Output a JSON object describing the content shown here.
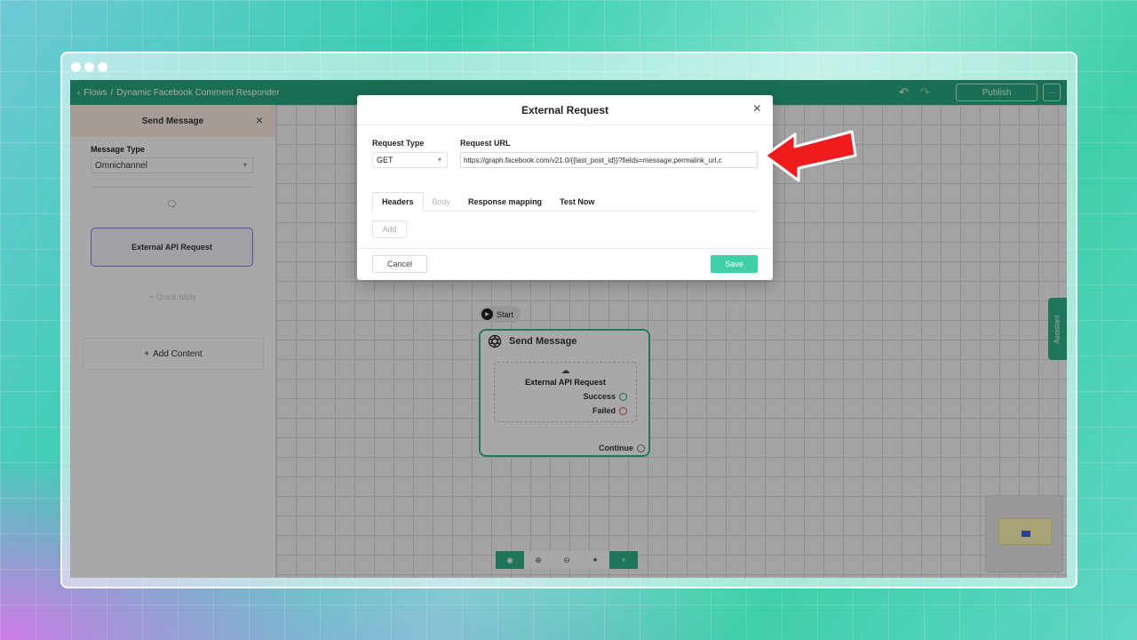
{
  "topbar": {
    "back_link": "Flows",
    "separator": "/",
    "flow_name": "Dynamic Facebook Comment Responder",
    "publish_label": "Publish",
    "more_label": "···"
  },
  "sidebar": {
    "title": "Send Message",
    "message_type_label": "Message Type",
    "message_type_value": "Omnichannel",
    "api_card_label": "External API Request",
    "quick_reply_label": "+ Quick reply",
    "add_content_label": "Add Content"
  },
  "canvas": {
    "start_label": "Start",
    "node_title": "Send Message",
    "node_api_label": "External API Request",
    "success_label": "Success",
    "failed_label": "Failed",
    "continue_label": "Continue",
    "assistant_label": "Assistant"
  },
  "modal": {
    "title": "External Request",
    "request_type_label": "Request Type",
    "request_type_value": "GET",
    "request_url_label": "Request URL",
    "request_url_value": "https://graph.facebook.com/v21.0/{{last_post_id}}?fields=message,permalink_url,c",
    "tabs": [
      {
        "label": "Headers"
      },
      {
        "label": "Body"
      },
      {
        "label": "Response mapping"
      },
      {
        "label": "Test Now"
      }
    ],
    "add_label": "Add",
    "cancel_label": "Cancel",
    "save_label": "Save"
  },
  "colors": {
    "brand_green": "#26a77e",
    "save_green": "#3fd1a6",
    "annotation_arrow": "#ee1c1c"
  },
  "icons": [
    "undo-icon",
    "redo-icon",
    "close-icon",
    "chat-icon",
    "play-icon",
    "openai-icon",
    "cloud-upload-icon",
    "eye-icon",
    "zoom-in-icon",
    "zoom-out-icon",
    "fit-view-icon",
    "plus-icon",
    "chevron-left-icon"
  ]
}
